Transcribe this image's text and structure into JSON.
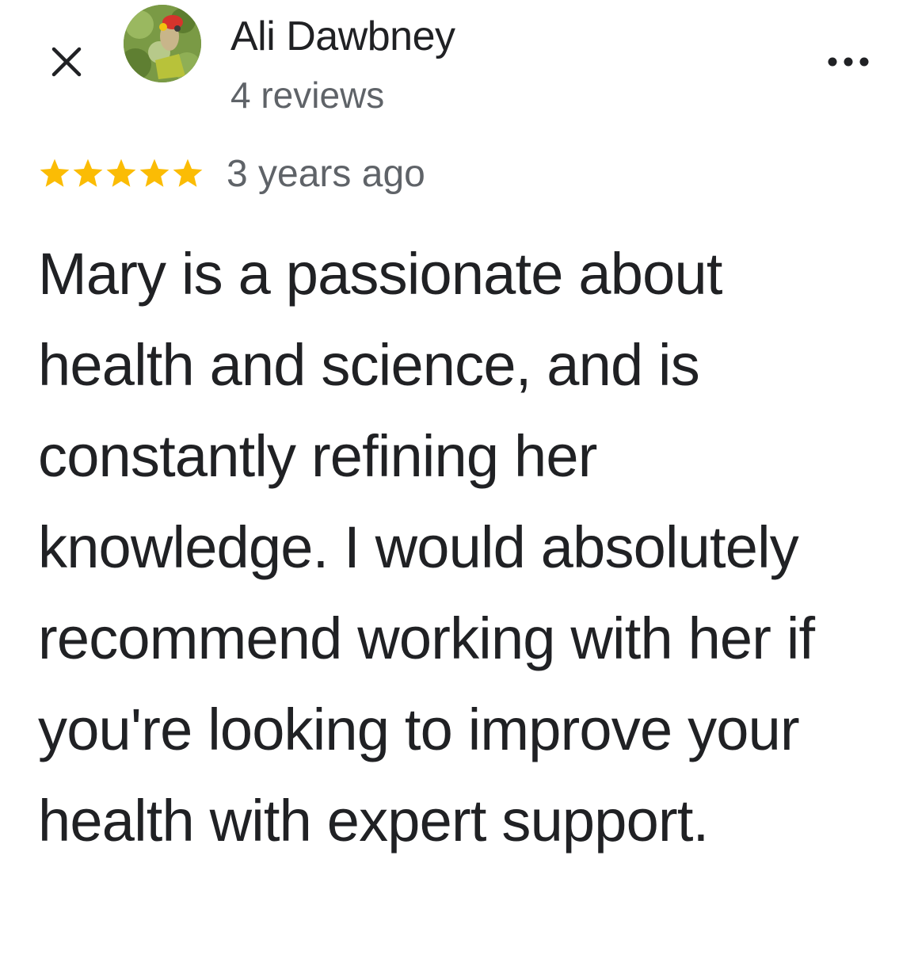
{
  "header": {
    "close_icon": "close-icon",
    "more_icon": "more-horizontal-icon",
    "avatar_icon": "profile-photo"
  },
  "review": {
    "author": "Ali Dawbney",
    "reviews_count": "4 reviews",
    "rating": 5,
    "rating_max": 5,
    "star_color": "#fbbc04",
    "time_ago": "3 years ago",
    "text": "Mary is a passionate about health and science, and is constantly refining her knowledge. I would absolutely recommend working with her if you're looking to improve your health with expert support."
  }
}
